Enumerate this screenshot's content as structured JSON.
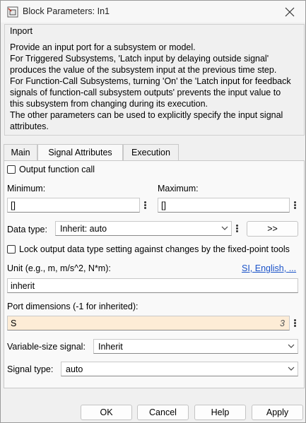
{
  "window": {
    "title": "Block Parameters: In1"
  },
  "description": {
    "heading": "Inport",
    "lines": [
      "Provide an input port for a subsystem or model.",
      "For Triggered Subsystems, 'Latch input by delaying outside signal'",
      "produces the value of the subsystem input at the previous time step.",
      "For Function-Call Subsystems, turning 'On' the 'Latch input for feedback",
      "signals of function-call subsystem outputs' prevents the input value to",
      "this subsystem from changing during its execution.",
      "The other parameters can be used to explicitly specify the input signal",
      "attributes."
    ]
  },
  "tabs": [
    {
      "label": "Main",
      "active": false
    },
    {
      "label": "Signal Attributes",
      "active": true
    },
    {
      "label": "Execution",
      "active": false
    }
  ],
  "signal_attributes": {
    "output_function_call": {
      "label": "Output function call",
      "checked": false
    },
    "minimum": {
      "label": "Minimum:",
      "value": "[]"
    },
    "maximum": {
      "label": "Maximum:",
      "value": "[]"
    },
    "data_type": {
      "label": "Data type:",
      "value": "Inherit: auto",
      "assistant_button": ">>"
    },
    "lock_output": {
      "label": "Lock output data type setting against changes by the fixed-point tools",
      "checked": false
    },
    "unit": {
      "label": "Unit (e.g., m, m/s^2, N*m):",
      "link": "SI, English, ...",
      "value": "inherit"
    },
    "port_dimensions": {
      "label": "Port dimensions (-1 for inherited):",
      "value": "S",
      "count_badge": "3"
    },
    "variable_size": {
      "label": "Variable-size signal:",
      "value": "Inherit"
    },
    "signal_type": {
      "label": "Signal type:",
      "value": "auto"
    }
  },
  "buttons": {
    "ok": "OK",
    "cancel": "Cancel",
    "help": "Help",
    "apply": "Apply"
  }
}
